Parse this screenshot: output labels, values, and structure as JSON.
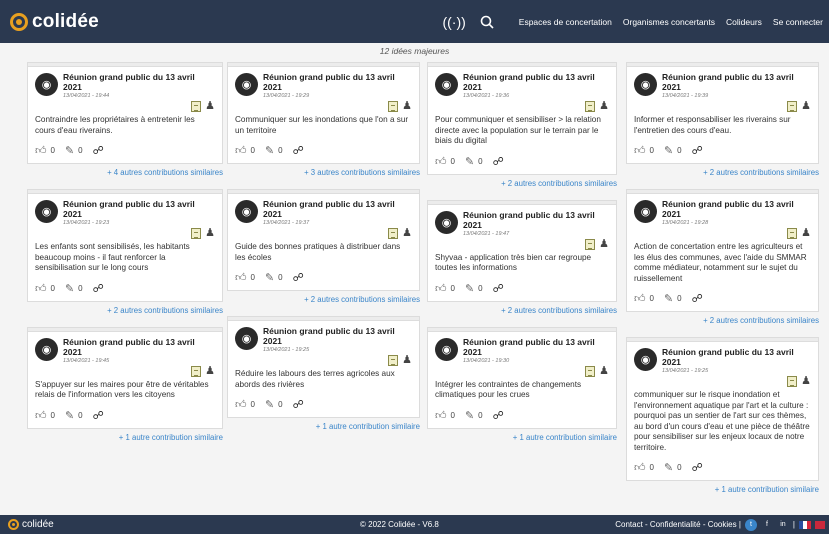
{
  "header": {
    "brand": "colidée",
    "nav": [
      "Espaces de concertation",
      "Organismes concertants",
      "Colideurs",
      "Se connecter"
    ]
  },
  "count_label": "12 idées majeures",
  "columns": [
    [
      {
        "title": "Réunion grand public du 13 avril 2021",
        "date": "13/04/2021 - 19:44",
        "text": "Contraindre les propriétaires à entretenir les cours d'eau riverains.",
        "likes": "0",
        "comments": "0",
        "similar": "+ 4 autres contributions similaires"
      },
      {
        "title": "Réunion grand public du 13 avril 2021",
        "date": "13/04/2021 - 19:23",
        "text": "Les enfants sont sensibilisés, les habitants beaucoup moins - il faut renforcer la sensibilisation sur le long cours",
        "likes": "0",
        "comments": "0",
        "similar": "+ 2 autres contributions similaires"
      },
      {
        "title": "Réunion grand public du 13 avril 2021",
        "date": "13/04/2021 - 19:45",
        "text": "S'appuyer sur les maires pour être de véritables relais de l'information vers les citoyens",
        "likes": "0",
        "comments": "0",
        "similar": "+ 1 autre contribution similaire"
      }
    ],
    [
      {
        "title": "Réunion grand public du 13 avril 2021",
        "date": "13/04/2021 - 19:29",
        "text": "Communiquer sur les inondations que l'on a sur un territoire",
        "likes": "0",
        "comments": "0",
        "similar": "+ 3 autres contributions similaires"
      },
      {
        "title": "Réunion grand public du 13 avril 2021",
        "date": "13/04/2021 - 19:37",
        "text": "Guide des bonnes pratiques à distribuer dans les écoles",
        "likes": "0",
        "comments": "0",
        "similar": "+ 2 autres contributions similaires"
      },
      {
        "title": "Réunion grand public du 13 avril 2021",
        "date": "13/04/2021 - 19:25",
        "text": "Réduire les labours des terres agricoles aux abords des rivières",
        "likes": "0",
        "comments": "0",
        "similar": "+ 1 autre contribution similaire"
      }
    ],
    [
      {
        "title": "Réunion grand public du 13 avril 2021",
        "date": "13/04/2021 - 19:36",
        "text": "Pour communiquer et sensibiliser > la relation directe avec la population sur le terrain par le biais du digital",
        "likes": "0",
        "comments": "0",
        "similar": "+ 2 autres contributions similaires"
      },
      {
        "title": "Réunion grand public du 13 avril 2021",
        "date": "13/04/2021 - 19:47",
        "text": "Shyvaa - application très bien car regroupe toutes les informations",
        "likes": "0",
        "comments": "0",
        "similar": "+ 2 autres contributions similaires"
      },
      {
        "title": "Réunion grand public du 13 avril 2021",
        "date": "13/04/2021 - 19:30",
        "text": "Intégrer les contraintes de changements climatiques pour les crues",
        "likes": "0",
        "comments": "0",
        "similar": "+ 1 autre contribution similaire"
      }
    ],
    [
      {
        "title": "Réunion grand public du 13 avril 2021",
        "date": "13/04/2021 - 19:39",
        "text": "Informer et responsabiliser les riverains sur l'entretien des cours d'eau.",
        "likes": "0",
        "comments": "0",
        "similar": "+ 2 autres contributions similaires"
      },
      {
        "title": "Réunion grand public du 13 avril 2021",
        "date": "13/04/2021 - 19:28",
        "text": "Action de concertation entre les agriculteurs et les élus des communes, avec l'aide du SMMAR comme médiateur, notamment sur le sujet du ruissellement",
        "likes": "0",
        "comments": "0",
        "similar": "+ 2 autres contributions similaires"
      },
      {
        "title": "Réunion grand public du 13 avril 2021",
        "date": "13/04/2021 - 19:25",
        "text": "communiquer sur le risque inondation et l'environnement aquatique par l'art et la culture : pourquoi pas un sentier de l'art sur ces thèmes, au bord d'un cours d'eau et une pièce de théâtre pour sensibiliser sur les enjeux locaux de notre territoire.",
        "likes": "0",
        "comments": "0",
        "similar": "+ 1 autre contribution similaire"
      }
    ]
  ],
  "footer": {
    "brand": "colidée",
    "copyright": "© 2022 Colidée - V6.8",
    "links": "Contact - Confidentialité - Cookies |"
  }
}
